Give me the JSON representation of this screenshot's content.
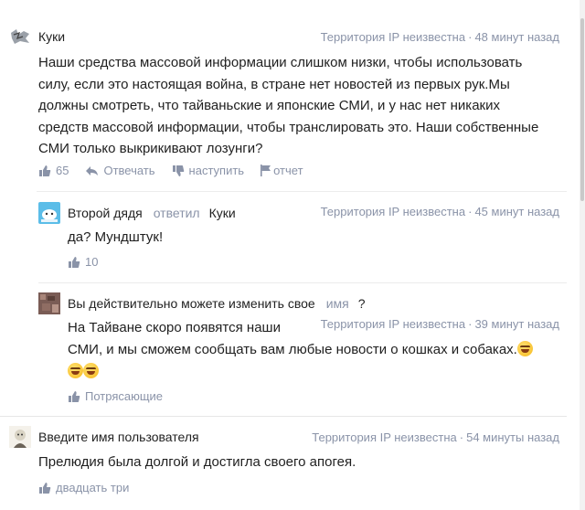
{
  "comments": [
    {
      "author": "Куки",
      "location": "Территория IP неизвестна",
      "time": "48 минут назад",
      "text": "Наши средства массовой информации слишком низки, чтобы использовать силу, если это настоящая война, в стране нет новостей из первых рук.Мы должны смотреть, что тайваньские и японские СМИ, и у нас нет никаких средств массовой информации, чтобы транслировать это. Наши собственные СМИ только выкрикивают лозунги?",
      "likes": "65",
      "reply_label": "Отвечать",
      "dislike_label": "наступить",
      "report_label": "отчет"
    }
  ],
  "replies": [
    {
      "author": "Второй дядя",
      "replied_label": "ответил",
      "reply_to": "Куки",
      "location": "Территория IP неизвестна",
      "time": "45 минут назад",
      "text": "да? Мундштук!",
      "likes": "10"
    },
    {
      "prefix": "Вы действительно можете изменить свое",
      "name_word": "имя",
      "suffix": "?",
      "location": "Территория IP неизвестна",
      "time": "39 минут назад",
      "text_line1": "На Тайване скоро появятся наши",
      "text_line2": "СМИ, и мы сможем сообщать вам любые новости о кошках и собаках.",
      "likes": "Потрясающие"
    }
  ],
  "comment2": {
    "author": "Введите имя пользователя",
    "location": "Территория IP неизвестна",
    "time": "54 минуты назад",
    "text": "Прелюдия была долгой и достигла своего апогея.",
    "likes": "двадцать три"
  },
  "meta_separator": "·",
  "colors": {
    "meta": "#8a93a8",
    "text": "#1f1f1f",
    "divider": "#ececec"
  }
}
